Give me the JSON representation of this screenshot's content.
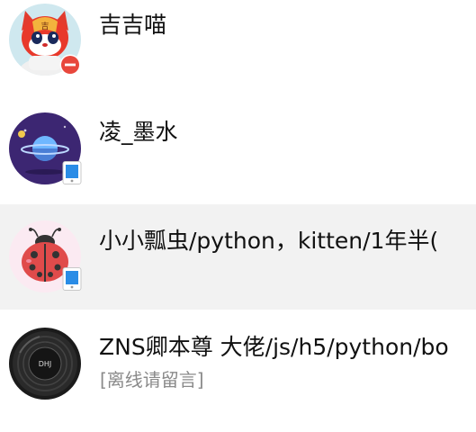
{
  "contacts": [
    {
      "name": "吉吉喵",
      "status": "do-not-disturb",
      "avatar_icon": "cartoon-cat-icon",
      "status_color": "#e8473c"
    },
    {
      "name": "凌_墨水",
      "status": "mobile-online",
      "avatar_icon": "planet-icon",
      "status_color": "#2a8ce6"
    },
    {
      "name": "小小瓢虫/python，kitten/1年半(",
      "status": "mobile-online",
      "avatar_icon": "ladybug-icon",
      "status_color": "#2a8ce6",
      "selected": true
    },
    {
      "name": "ZNS卿本尊 大佬/js/h5/python/bo",
      "subtext": "[离线请留言]",
      "avatar_icon": "vinyl-disc-icon"
    }
  ]
}
